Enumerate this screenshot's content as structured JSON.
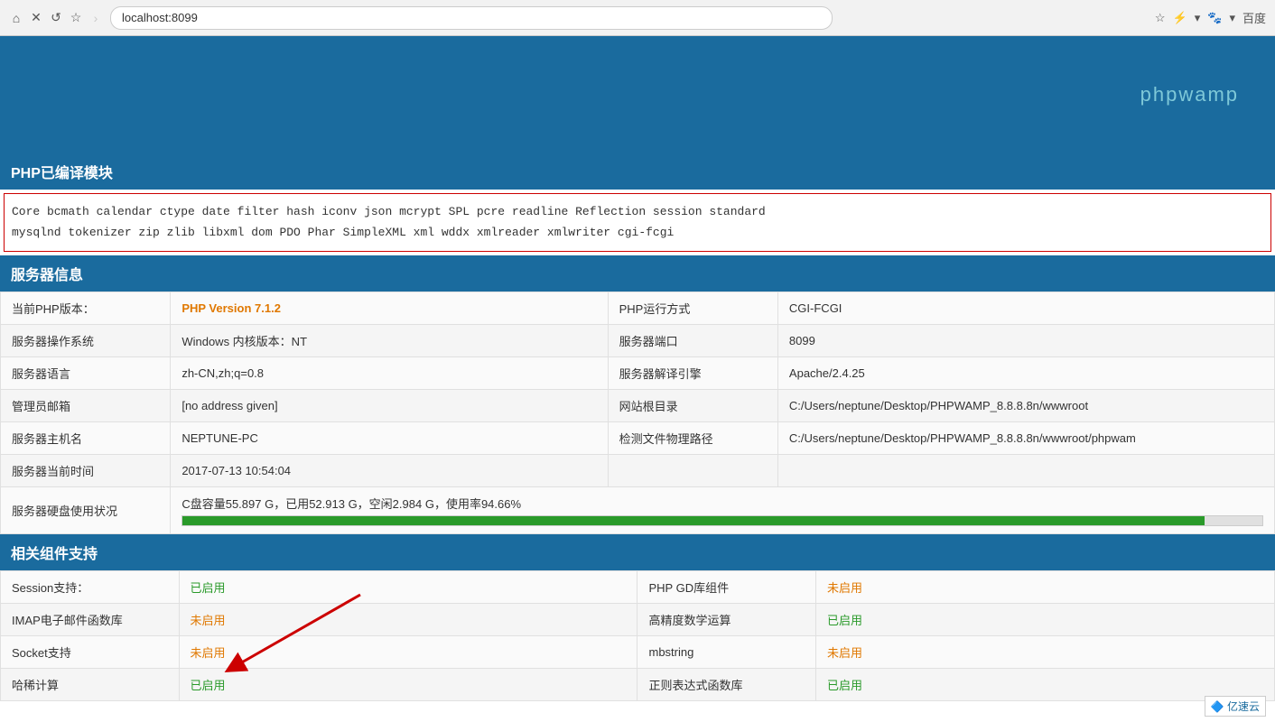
{
  "browser": {
    "url": "localhost:8099",
    "search_engine": "百度"
  },
  "header": {
    "title": "phpwamp",
    "background_color": "#1a6b9e"
  },
  "php_modules": {
    "section_title": "PHP已编译模块",
    "modules_line1": "Core  bcmath  calendar  ctype  date  filter  hash  iconv  json  mcrypt  SPL  pcre  readline  Reflection  session  standard",
    "modules_line2": "mysqlnd  tokenizer  zip  zlib  libxml  dom  PDO  Phar  SimpleXML  xml  wddx  xmlreader  xmlwriter  cgi-fcgi"
  },
  "server_info": {
    "section_title": "服务器信息",
    "rows": [
      {
        "label1": "当前PHP版本：",
        "value1": "PHP Version 7.1.2",
        "value1_special": true,
        "label2": "PHP运行方式",
        "value2": "CGI-FCGI"
      },
      {
        "label1": "服务器操作系统",
        "value1": "Windows  内核版本：NT",
        "label2": "服务器端口",
        "value2": "8099"
      },
      {
        "label1": "服务器语言",
        "value1": "zh-CN,zh;q=0.8",
        "label2": "服务器解译引擎",
        "value2": "Apache/2.4.25"
      },
      {
        "label1": "管理员邮箱",
        "value1": "[no address given]",
        "label2": "网站根目录",
        "value2": "C:/Users/neptune/Desktop/PHPWAMP_8.8.8.8n/wwwroot"
      },
      {
        "label1": "服务器主机名",
        "value1": "NEPTUNE-PC",
        "label2": "检测文件物理路径",
        "value2": "C:/Users/neptune/Desktop/PHPWAMP_8.8.8.8n/wwwroot/phpwam"
      },
      {
        "label1": "服务器当前时间",
        "value1": "2017-07-13 10:54:04",
        "label2": "",
        "value2": ""
      },
      {
        "label1": "服务器硬盘使用状况",
        "value1": "C盘容量55.897 G，已用52.913 G，空闲2.984 G，使用率94.66%",
        "disk_bar": true,
        "disk_percent": 94.66,
        "label2": "",
        "value2": ""
      }
    ]
  },
  "components": {
    "section_title": "相关组件支持",
    "rows": [
      {
        "label1": "Session支持：",
        "value1": "已启用",
        "value1_enabled": true,
        "label2": "PHP GD库组件",
        "value2": "未启用",
        "value2_enabled": false
      },
      {
        "label1": "IMAP电子邮件函数库",
        "value1": "未启用",
        "value1_enabled": false,
        "label2": "高精度数学运算",
        "value2": "已启用",
        "value2_enabled": true,
        "has_arrow": true
      },
      {
        "label1": "Socket支持",
        "value1": "未启用",
        "value1_enabled": false,
        "label2": "mbstring",
        "value2": "未启用",
        "value2_enabled": false
      },
      {
        "label1": "哈稀计算",
        "value1": "已启用",
        "value1_enabled": true,
        "label2": "正则表达式函数库",
        "value2": "已启用",
        "value2_enabled": true
      }
    ]
  },
  "watermark": {
    "text": "亿速云"
  },
  "labels": {
    "enabled": "已启用",
    "disabled": "未启用"
  }
}
